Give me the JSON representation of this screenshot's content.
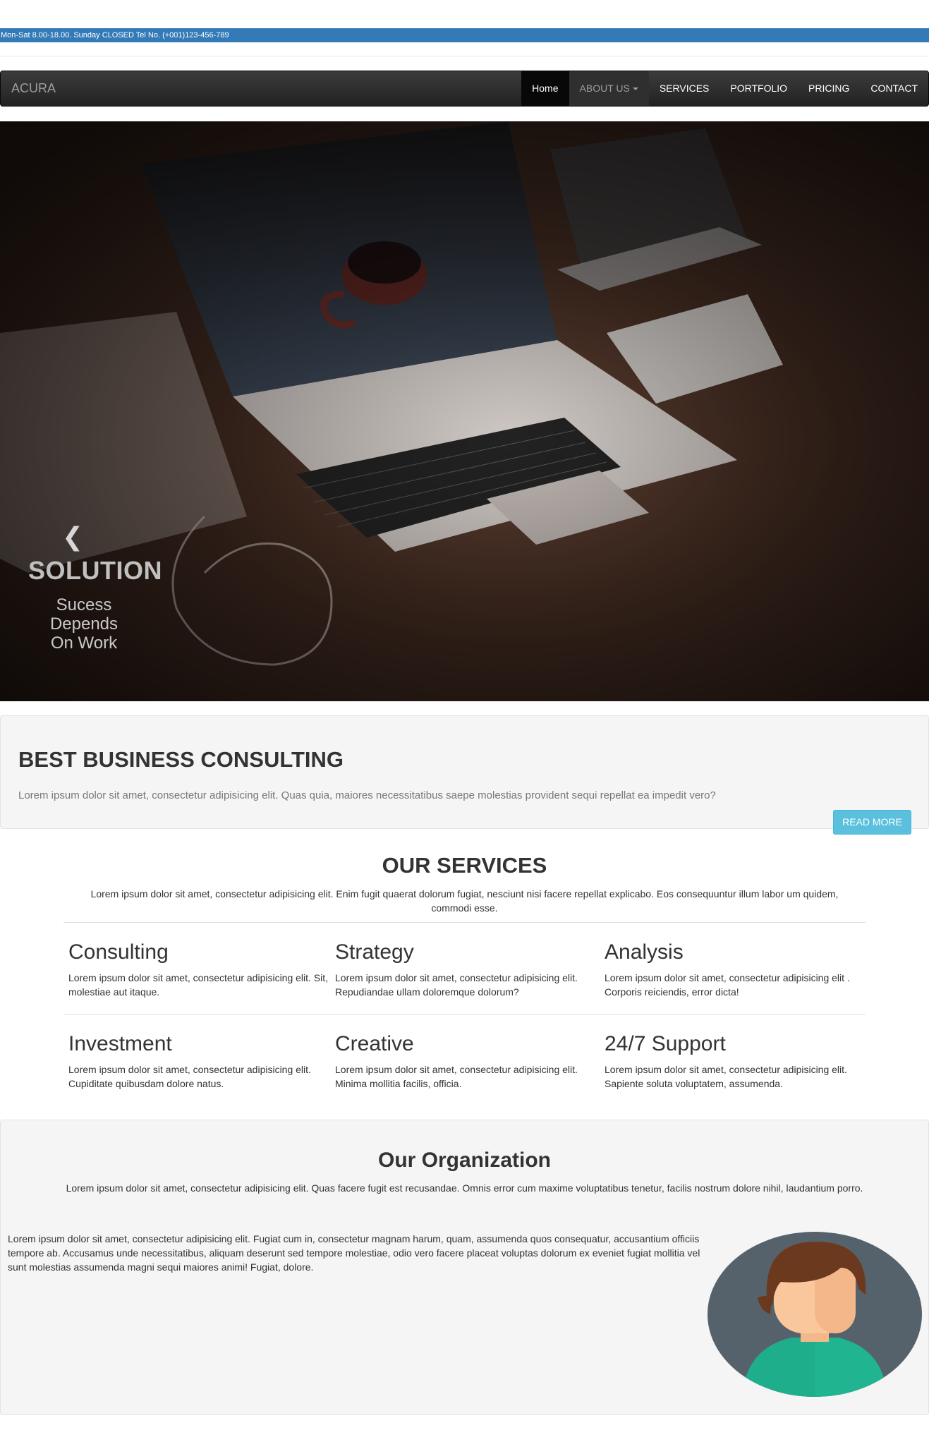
{
  "topbar": {
    "text": "Mon-Sat 8.00-18.00. Sunday CLOSED Tel No. (+001)123-456-789"
  },
  "navbar": {
    "brand": "ACURA",
    "items": [
      {
        "label": "Home"
      },
      {
        "label": "ABOUT US"
      },
      {
        "label": "SERVICES"
      },
      {
        "label": "PORTFOLIO"
      },
      {
        "label": "PRICING"
      },
      {
        "label": "CONTACT"
      }
    ]
  },
  "hero": {
    "title": "SOLUTION",
    "subtitle": "Sucess Depends On Work",
    "prev_icon": "chevron-left-icon",
    "slides": 3,
    "active_slide": 1
  },
  "well": {
    "title": "BEST BUSINESS CONSULTING",
    "text": "Lorem ipsum dolor sit amet, consectetur adipisicing elit. Quas quia, maiores necessitatibus saepe molestias provident sequi repellat ea impedit vero?",
    "button": "READ MORE"
  },
  "services": {
    "title": "OUR SERVICES",
    "intro": "Lorem ipsum dolor sit amet, consectetur adipisicing elit. Enim fugit quaerat dolorum fugiat, nesciunt nisi facere repellat explicabo. Eos consequuntur illum labor um quidem, commodi esse.",
    "items": [
      {
        "title": "Consulting",
        "text": "Lorem ipsum dolor sit amet, consectetur adipisicing elit. Sit, molestiae aut itaque."
      },
      {
        "title": "Strategy",
        "text": "Lorem ipsum dolor sit amet, consectetur adipisicing elit. Repudiandae ullam doloremque dolorum?"
      },
      {
        "title": "Analysis",
        "text": "Lorem ipsum dolor sit amet, consectetur adipisicing elit . Corporis reiciendis, error dicta!"
      },
      {
        "title": "Investment",
        "text": "Lorem ipsum dolor sit amet, consectetur adipisicing elit. Cupiditate quibusdam dolore natus."
      },
      {
        "title": "Creative",
        "text": "Lorem ipsum dolor sit amet, consectetur adipisicing elit. Minima mollitia facilis, officia."
      },
      {
        "title": "24/7 Support",
        "text": "Lorem ipsum dolor sit amet, consectetur adipisicing elit. Sapiente soluta voluptatem, assumenda."
      }
    ]
  },
  "organization": {
    "title": "Our Organization",
    "intro": "Lorem ipsum dolor sit amet, consectetur adipisicing elit. Quas facere fugit est recusandae. Omnis error cum maxime voluptatibus tenetur, facilis nostrum dolore nihil, laudantium porro.",
    "body": "Lorem ipsum dolor sit amet, consectetur adipisicing elit. Fugiat cum in, consectetur magnam harum, quam, assumenda quos consequatur, accusantium officiis tempore ab. Accusamus unde necessitatibus, aliquam deserunt sed tempore molestiae, odio vero facere placeat voluptas dolorum ex eveniet fugiat mollitia vel sunt molestias assumenda magni sequi maiores animi! Fugiat, dolore."
  },
  "colors": {
    "topbar": "#337ab7",
    "navbar": "#222222",
    "button_info": "#5bc0de",
    "well_bg": "#f5f5f5"
  }
}
